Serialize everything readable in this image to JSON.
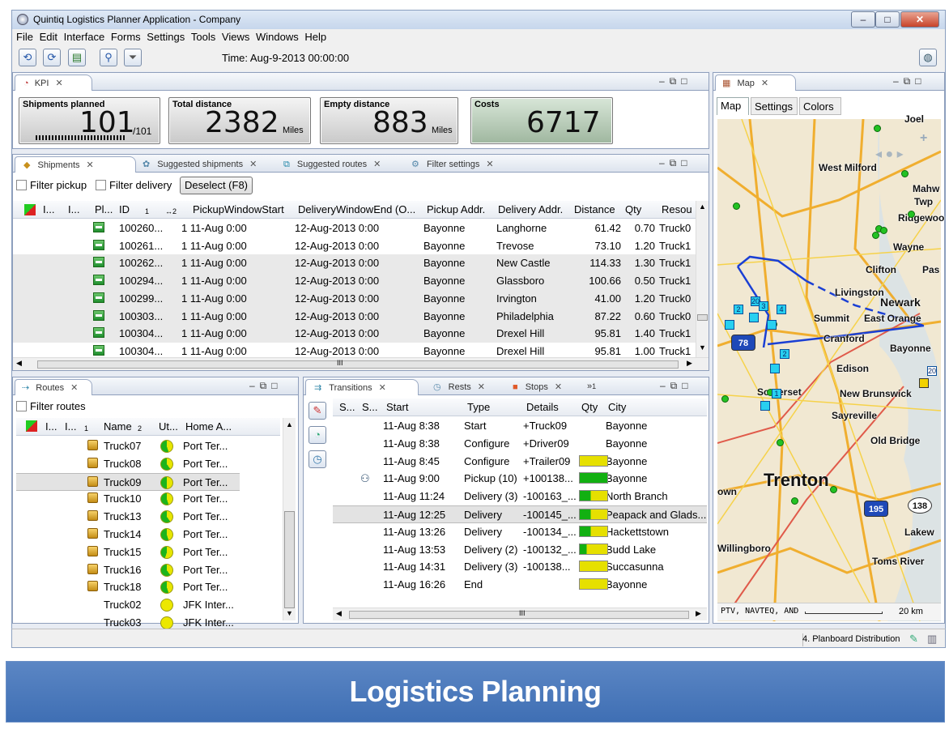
{
  "window": {
    "title": "Quintiq Logistics Planner Application - Company",
    "min": "–",
    "max": "□",
    "close": "✕"
  },
  "menu": [
    "File",
    "Edit",
    "Interface",
    "Forms",
    "Settings",
    "Tools",
    "Views",
    "Windows",
    "Help"
  ],
  "toolbar": {
    "time": "Time: Aug-9-2013 00:00:00"
  },
  "kpi": {
    "tab": "KPI",
    "cards": [
      {
        "label": "Shipments planned",
        "value": "101",
        "suffix": "/101",
        "unit": ""
      },
      {
        "label": "Total distance",
        "value": "2382",
        "unit": "Miles"
      },
      {
        "label": "Empty distance",
        "value": "883",
        "unit": "Miles"
      },
      {
        "label": "Costs",
        "value": "6717",
        "unit": ""
      }
    ]
  },
  "shipments": {
    "tabs": [
      "Shipments",
      "Suggested shipments",
      "Suggested routes",
      "Filter settings"
    ],
    "filter_pickup": "Filter pickup",
    "filter_delivery": "Filter delivery",
    "deselect": "Deselect (F8)",
    "columns": [
      "I...",
      "I...",
      "Pl...",
      "ID",
      "1",
      "↔2",
      "PickupWindowStart",
      "DeliveryWindowEnd (O...",
      "Pickup Addr.",
      "Delivery Addr.",
      "Distance",
      "Qty",
      "Resou"
    ],
    "rows": [
      {
        "id": "100260...",
        "start": "1 11-Aug 0:00",
        "end": "12-Aug-2013 0:00",
        "pickup": "Bayonne",
        "delivery": "Langhorne",
        "distance": "61.42",
        "qty": "0.70",
        "res": "Truck0"
      },
      {
        "id": "100261...",
        "start": "1 11-Aug 0:00",
        "end": "12-Aug-2013 0:00",
        "pickup": "Bayonne",
        "delivery": "Trevose",
        "distance": "73.10",
        "qty": "1.20",
        "res": "Truck1"
      },
      {
        "id": "100262...",
        "start": "1 11-Aug 0:00",
        "end": "12-Aug-2013 0:00",
        "pickup": "Bayonne",
        "delivery": "New Castle",
        "distance": "114.33",
        "qty": "1.30",
        "res": "Truck1"
      },
      {
        "id": "100294...",
        "start": "1 11-Aug 0:00",
        "end": "12-Aug-2013 0:00",
        "pickup": "Bayonne",
        "delivery": "Glassboro",
        "distance": "100.66",
        "qty": "0.50",
        "res": "Truck1"
      },
      {
        "id": "100299...",
        "start": "1 11-Aug 0:00",
        "end": "12-Aug-2013 0:00",
        "pickup": "Bayonne",
        "delivery": "Irvington",
        "distance": "41.00",
        "qty": "1.20",
        "res": "Truck0"
      },
      {
        "id": "100303...",
        "start": "1 11-Aug 0:00",
        "end": "12-Aug-2013 0:00",
        "pickup": "Bayonne",
        "delivery": "Philadelphia",
        "distance": "87.22",
        "qty": "0.60",
        "res": "Truck0"
      },
      {
        "id": "100304...",
        "start": "1 11-Aug 0:00",
        "end": "12-Aug-2013 0:00",
        "pickup": "Bayonne",
        "delivery": "Drexel Hill",
        "distance": "95.81",
        "qty": "1.40",
        "res": "Truck1"
      },
      {
        "id": "100304...",
        "start": "1 11-Aug 0:00",
        "end": "12-Aug-2013 0:00",
        "pickup": "Bayonne",
        "delivery": "Drexel Hill",
        "distance": "95.81",
        "qty": "1.00",
        "res": "Truck1"
      }
    ],
    "hscroll_mark": "III"
  },
  "routes": {
    "tab": "Routes",
    "filter": "Filter routes",
    "columns": [
      "I...",
      "I...",
      "1",
      "Name",
      "2",
      "Ut...",
      "Home A..."
    ],
    "rows": [
      {
        "name": "Truck07",
        "home": "Port Ter...",
        "util": 0.55
      },
      {
        "name": "Truck08",
        "home": "Port Ter...",
        "util": 0.6
      },
      {
        "name": "Truck09",
        "home": "Port Ter...",
        "util": 0.5
      },
      {
        "name": "Truck10",
        "home": "Port Ter...",
        "util": 0.55
      },
      {
        "name": "Truck13",
        "home": "Port Ter...",
        "util": 0.6
      },
      {
        "name": "Truck14",
        "home": "Port Ter...",
        "util": 0.55
      },
      {
        "name": "Truck15",
        "home": "Port Ter...",
        "util": 0.45
      },
      {
        "name": "Truck16",
        "home": "Port Ter...",
        "util": 0.6
      },
      {
        "name": "Truck18",
        "home": "Port Ter...",
        "util": 0.55
      },
      {
        "name": "Truck02",
        "home": "JFK Inter...",
        "util": 0.0
      },
      {
        "name": "Truck03",
        "home": "JFK Inter...",
        "util": 0.0
      }
    ]
  },
  "transitions": {
    "tabs": [
      "Transitions",
      "Rests",
      "Stops",
      "»",
      "1"
    ],
    "columns": [
      "S...",
      "S...",
      "Start",
      "Type",
      "Details",
      "Qty",
      "City"
    ],
    "rows": [
      {
        "start": "11-Aug 8:38",
        "type": "Start",
        "details": "+Truck09",
        "city": "Bayonne",
        "bar": ""
      },
      {
        "start": "11-Aug 8:38",
        "type": "Configure",
        "details": "+Driver09",
        "city": "Bayonne",
        "bar": ""
      },
      {
        "start": "11-Aug 8:45",
        "type": "Configure",
        "details": "+Trailer09",
        "city": "Bayonne",
        "bar": "yellow"
      },
      {
        "start": "11-Aug 9:00",
        "type": "Pickup (10)",
        "details": "+100138...",
        "city": "Bayonne",
        "bar": "green"
      },
      {
        "start": "11-Aug 11:24",
        "type": "Delivery (3)",
        "details": "-100163_...",
        "city": "North Branch",
        "bar": "mix"
      },
      {
        "start": "11-Aug 12:25",
        "type": "Delivery",
        "details": "-100145_...",
        "city": "Peapack and Glads...",
        "bar": "mix"
      },
      {
        "start": "11-Aug 13:26",
        "type": "Delivery",
        "details": "-100134_...",
        "city": "Hackettstown",
        "bar": "mix"
      },
      {
        "start": "11-Aug 13:53",
        "type": "Delivery (2)",
        "details": "-100132_...",
        "city": "Budd Lake",
        "bar": "mix2"
      },
      {
        "start": "11-Aug 14:31",
        "type": "Delivery (3)",
        "details": "-100138...",
        "city": "Succasunna",
        "bar": "yellow"
      },
      {
        "start": "11-Aug 16:26",
        "type": "End",
        "details": "",
        "city": "Bayonne",
        "bar": "yellow"
      }
    ],
    "hscroll_mark": "III"
  },
  "map": {
    "tab": "Map",
    "subtabs": [
      "Map",
      "Settings",
      "Colors"
    ],
    "labels": [
      "West Milford",
      "Mahw",
      "Twp",
      "Ridgewoo",
      "Wayne",
      "Clifton",
      "Pas",
      "Livingston",
      "Newark",
      "Summit",
      "East Orange",
      "Cranford",
      "Bayonne",
      "Edison",
      "Somerset",
      "New Brunswick",
      "Sayreville",
      "Old Bridge",
      "own",
      "Trenton",
      "Lakew",
      "Willingboro",
      "Toms River",
      "Joel",
      "20",
      "1",
      "2",
      "3",
      "4",
      "5",
      "6",
      "138",
      "195",
      "78"
    ],
    "copyright": "PTV, NAVTEQ, AND",
    "scale": "20 km"
  },
  "status": {
    "text": "4. Planboard Distribution"
  },
  "banner": {
    "title": "Logistics Planning"
  }
}
